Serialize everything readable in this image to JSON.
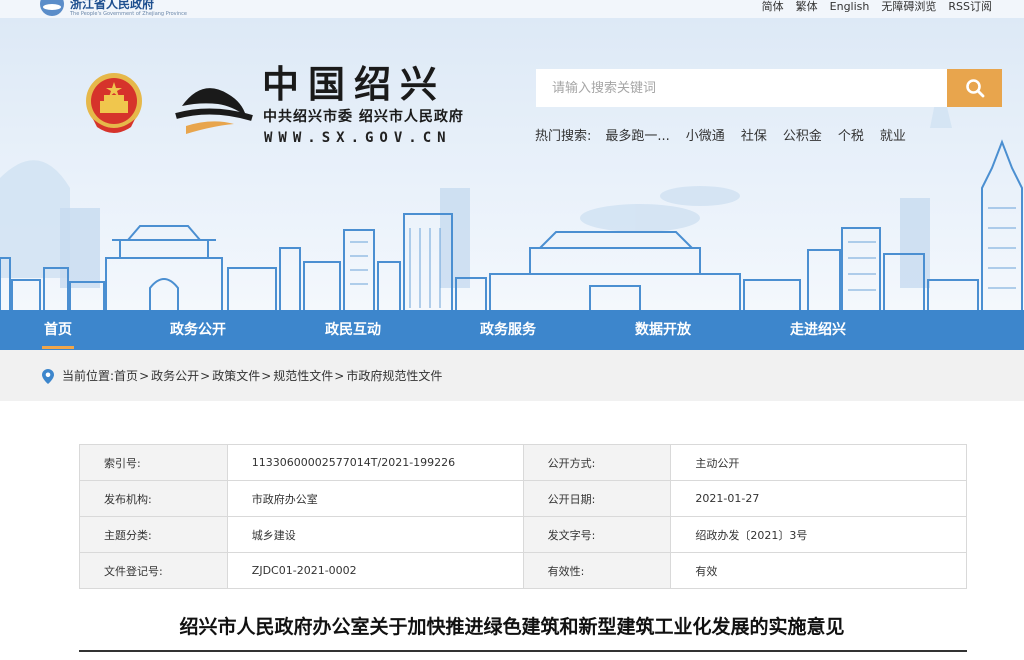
{
  "topbar": {
    "province_name": "浙江省人民政府",
    "province_en": "The People's Government of Zhejiang Province",
    "links": [
      "简体",
      "繁体",
      "English",
      "无障碍浏览",
      "RSS订阅"
    ]
  },
  "header": {
    "site_title": "中国绍兴",
    "site_subtitle": "中共绍兴市委  绍兴市人民政府",
    "site_url": "WWW.SX.GOV.CN"
  },
  "search": {
    "placeholder": "请输入搜索关键词",
    "hot_label": "热门搜索:",
    "hot_terms": [
      "最多跑一...",
      "小微通",
      "社保",
      "公积金",
      "个税",
      "就业"
    ]
  },
  "nav": {
    "items": [
      "首页",
      "政务公开",
      "政民互动",
      "政务服务",
      "数据开放",
      "走进绍兴"
    ],
    "active_index": 0
  },
  "breadcrumb": {
    "prefix": "当前位置:",
    "items": [
      "首页",
      "政务公开",
      "政策文件",
      "规范性文件",
      "市政府规范性文件"
    ]
  },
  "info_table": {
    "rows": [
      [
        {
          "k": "索引号:",
          "v": "11330600002577014T/2021-199226"
        },
        {
          "k": "公开方式:",
          "v": "主动公开"
        }
      ],
      [
        {
          "k": "发布机构:",
          "v": "市政府办公室"
        },
        {
          "k": "公开日期:",
          "v": "2021-01-27"
        }
      ],
      [
        {
          "k": "主题分类:",
          "v": "城乡建设"
        },
        {
          "k": "发文字号:",
          "v": "绍政办发〔2021〕3号"
        }
      ],
      [
        {
          "k": "文件登记号:",
          "v": "ZJDC01-2021-0002"
        },
        {
          "k": "有效性:",
          "v": "有效"
        }
      ]
    ]
  },
  "document": {
    "title": "绍兴市人民政府办公室关于加快推进绿色建筑和新型建筑工业化发展的实施意见"
  },
  "colors": {
    "nav_blue": "#3d86cc",
    "accent_orange": "#e8a54d",
    "skyline_blue": "#4b8fd1"
  },
  "icons": {
    "search": "magnifier-icon",
    "location": "map-pin-icon",
    "emblem": "national-emblem-icon"
  }
}
